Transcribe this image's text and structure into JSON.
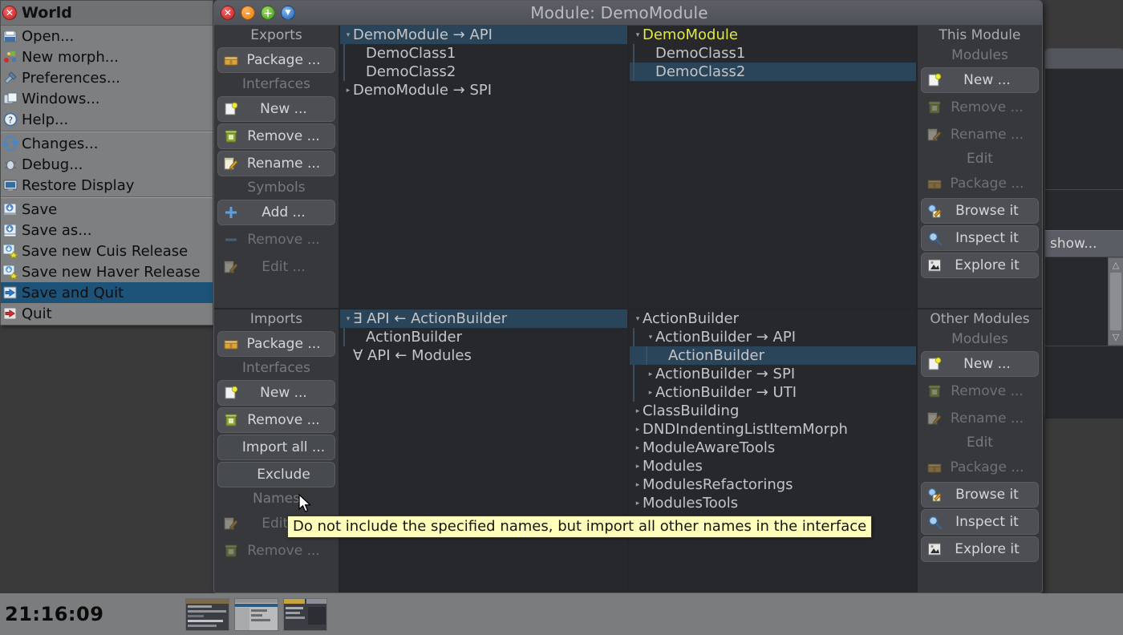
{
  "desktop": {
    "background_color": "#3a3a3a",
    "taskbar": {
      "clock": "21:16:09",
      "thumbnails": [
        "window-thumbnail-1",
        "window-thumbnail-2",
        "window-thumbnail-3"
      ]
    },
    "background_window": {
      "button_label": "show...",
      "scrollbar_up": "△",
      "scrollbar_down": "▽"
    }
  },
  "world_menu": {
    "title": "World",
    "close_icon": "close-icon",
    "items": [
      {
        "label": "Open...",
        "icon": "open-folder-icon",
        "selected": false,
        "separator_after": false
      },
      {
        "label": "New morph...",
        "icon": "new-morph-icon",
        "selected": false,
        "separator_after": false
      },
      {
        "label": "Preferences...",
        "icon": "preferences-icon",
        "selected": false,
        "separator_after": false
      },
      {
        "label": "Windows...",
        "icon": "windows-icon",
        "selected": false,
        "separator_after": false
      },
      {
        "label": "Help...",
        "icon": "help-icon",
        "selected": false,
        "separator_after": true
      },
      {
        "label": "Changes...",
        "icon": "changes-icon",
        "selected": false,
        "separator_after": false
      },
      {
        "label": "Debug...",
        "icon": "debug-icon",
        "selected": false,
        "separator_after": false
      },
      {
        "label": "Restore Display",
        "icon": "display-icon",
        "selected": false,
        "separator_after": true
      },
      {
        "label": "Save",
        "icon": "save-icon",
        "selected": false,
        "separator_after": false
      },
      {
        "label": "Save as...",
        "icon": "save-as-icon",
        "selected": false,
        "separator_after": false
      },
      {
        "label": "Save new Cuis Release",
        "icon": "save-release-icon",
        "selected": false,
        "separator_after": false
      },
      {
        "label": "Save new Haver Release",
        "icon": "save-release-icon",
        "selected": false,
        "separator_after": false
      },
      {
        "label": "Save and Quit",
        "icon": "save-quit-icon",
        "selected": true,
        "separator_after": false
      },
      {
        "label": "Quit",
        "icon": "quit-icon",
        "selected": false,
        "separator_after": false
      }
    ]
  },
  "module_window": {
    "title": "Module: DemoModule",
    "title_buttons": [
      {
        "name": "close-button",
        "glyph": "✕",
        "color": "#c81d1d"
      },
      {
        "name": "collapse-button",
        "glyph": "–",
        "color": "#e07a10"
      },
      {
        "name": "expand-button",
        "glyph": "＋",
        "color": "#3f9a17"
      },
      {
        "name": "menu-button",
        "glyph": "▼",
        "color": "#1f63b8"
      }
    ],
    "exports": {
      "section_label": "Exports",
      "groups": [
        {
          "label": "",
          "buttons": [
            {
              "label": "Package ...",
              "icon": "package-icon",
              "enabled": true
            }
          ]
        },
        {
          "label": "Interfaces",
          "buttons": [
            {
              "label": "New ...",
              "icon": "new-doc-icon",
              "enabled": true
            },
            {
              "label": "Remove ...",
              "icon": "trash-icon",
              "enabled": true
            },
            {
              "label": "Rename ...",
              "icon": "rename-icon",
              "enabled": true
            }
          ]
        },
        {
          "label": "Symbols",
          "buttons": [
            {
              "label": "Add ...",
              "icon": "plus-icon",
              "enabled": true
            },
            {
              "label": "Remove ...",
              "icon": "minus-icon",
              "enabled": false
            },
            {
              "label": "Edit ...",
              "icon": "rename-icon",
              "enabled": false
            }
          ]
        }
      ],
      "tree": [
        {
          "text": "DemoModule → API",
          "indent": 0,
          "arrow": "down",
          "selected": true,
          "guide": false
        },
        {
          "text": "DemoClass1",
          "indent": 1,
          "arrow": "none",
          "selected": false,
          "guide": true
        },
        {
          "text": "DemoClass2",
          "indent": 1,
          "arrow": "none",
          "selected": false,
          "guide": true
        },
        {
          "text": "DemoModule → SPI",
          "indent": 0,
          "arrow": "right",
          "selected": false,
          "guide": false
        }
      ]
    },
    "imports": {
      "section_label": "Imports",
      "groups": [
        {
          "label": "",
          "buttons": [
            {
              "label": "Package ...",
              "icon": "package-icon",
              "enabled": true
            }
          ]
        },
        {
          "label": "Interfaces",
          "buttons": [
            {
              "label": "New ...",
              "icon": "new-doc-icon",
              "enabled": true
            },
            {
              "label": "Remove ...",
              "icon": "trash-icon",
              "enabled": true
            }
          ]
        },
        {
          "label": "",
          "buttons": [
            {
              "label": "Import all ...",
              "icon": "none",
              "enabled": true
            },
            {
              "label": "Exclude",
              "icon": "none",
              "enabled": true
            }
          ]
        },
        {
          "label": "Names",
          "buttons": [
            {
              "label": "Edit ...",
              "icon": "rename-icon",
              "enabled": false
            },
            {
              "label": "Remove ...",
              "icon": "trash-icon",
              "enabled": false
            }
          ]
        }
      ],
      "tree": [
        {
          "text": "∃ API ← ActionBuilder",
          "indent": 0,
          "arrow": "down",
          "selected": true,
          "guide": false
        },
        {
          "text": "ActionBuilder",
          "indent": 1,
          "arrow": "none",
          "selected": false,
          "guide": true
        },
        {
          "text": "∀ API ← Modules",
          "indent": 0,
          "arrow": "none",
          "selected": false,
          "guide": false
        }
      ]
    },
    "this_module": {
      "section_label": "This Module",
      "groups": [
        {
          "label": "Modules",
          "buttons": [
            {
              "label": "New ...",
              "icon": "new-doc-icon",
              "enabled": true
            },
            {
              "label": "Remove ...",
              "icon": "trash-icon",
              "enabled": false
            },
            {
              "label": "Rename ...",
              "icon": "rename-icon",
              "enabled": false
            }
          ]
        },
        {
          "label": "Edit",
          "buttons": [
            {
              "label": "Package ...",
              "icon": "package-icon",
              "enabled": false
            },
            {
              "label": "Browse it",
              "icon": "browse-icon",
              "enabled": true
            },
            {
              "label": "Inspect it",
              "icon": "inspect-icon",
              "enabled": true
            },
            {
              "label": "Explore it",
              "icon": "explore-icon",
              "enabled": true
            }
          ]
        }
      ],
      "tree": [
        {
          "text": "DemoModule",
          "indent": 0,
          "arrow": "down",
          "selected": false,
          "highlight": true,
          "guide": false
        },
        {
          "text": "DemoClass1",
          "indent": 1,
          "arrow": "none",
          "selected": false,
          "highlight": false,
          "guide": true
        },
        {
          "text": "DemoClass2",
          "indent": 1,
          "arrow": "none",
          "selected": true,
          "highlight": false,
          "guide": true
        }
      ]
    },
    "other_modules": {
      "section_label": "Other Modules",
      "groups": [
        {
          "label": "Modules",
          "buttons": [
            {
              "label": "New ...",
              "icon": "new-doc-icon",
              "enabled": true
            },
            {
              "label": "Remove ...",
              "icon": "trash-icon",
              "enabled": false
            },
            {
              "label": "Rename ...",
              "icon": "rename-icon",
              "enabled": false
            }
          ]
        },
        {
          "label": "Edit",
          "buttons": [
            {
              "label": "Package ...",
              "icon": "package-icon",
              "enabled": false
            },
            {
              "label": "Browse it",
              "icon": "browse-icon",
              "enabled": true
            },
            {
              "label": "Inspect it",
              "icon": "inspect-icon",
              "enabled": true
            },
            {
              "label": "Explore it",
              "icon": "explore-icon",
              "enabled": true
            }
          ]
        }
      ],
      "tree": [
        {
          "text": "ActionBuilder",
          "indent": 0,
          "arrow": "down",
          "selected": false,
          "guide": false
        },
        {
          "text": "ActionBuilder → API",
          "indent": 1,
          "arrow": "down",
          "selected": false,
          "guide": true
        },
        {
          "text": "ActionBuilder",
          "indent": 2,
          "arrow": "none",
          "selected": true,
          "guide": true
        },
        {
          "text": "ActionBuilder → SPI",
          "indent": 1,
          "arrow": "right",
          "selected": false,
          "guide": true
        },
        {
          "text": "ActionBuilder → UTI",
          "indent": 1,
          "arrow": "right",
          "selected": false,
          "guide": true
        },
        {
          "text": "ClassBuilding",
          "indent": 0,
          "arrow": "right",
          "selected": false,
          "guide": false
        },
        {
          "text": "DNDIndentingListItemMorph",
          "indent": 0,
          "arrow": "right",
          "selected": false,
          "guide": false
        },
        {
          "text": "ModuleAwareTools",
          "indent": 0,
          "arrow": "right",
          "selected": false,
          "guide": false
        },
        {
          "text": "Modules",
          "indent": 0,
          "arrow": "right",
          "selected": false,
          "guide": false
        },
        {
          "text": "ModulesRefactorings",
          "indent": 0,
          "arrow": "right",
          "selected": false,
          "guide": false
        },
        {
          "text": "ModulesTools",
          "indent": 0,
          "arrow": "right",
          "selected": false,
          "guide": false
        }
      ]
    }
  },
  "tooltip": {
    "text": "Do not include the specified names, but import all other names in the interface"
  },
  "colors": {
    "selection": "#2a4459",
    "highlight_text": "#e2e845",
    "panel_bg": "#26282c",
    "button_bg": "#4d4f54",
    "tooltip_bg": "#ffffbb"
  }
}
